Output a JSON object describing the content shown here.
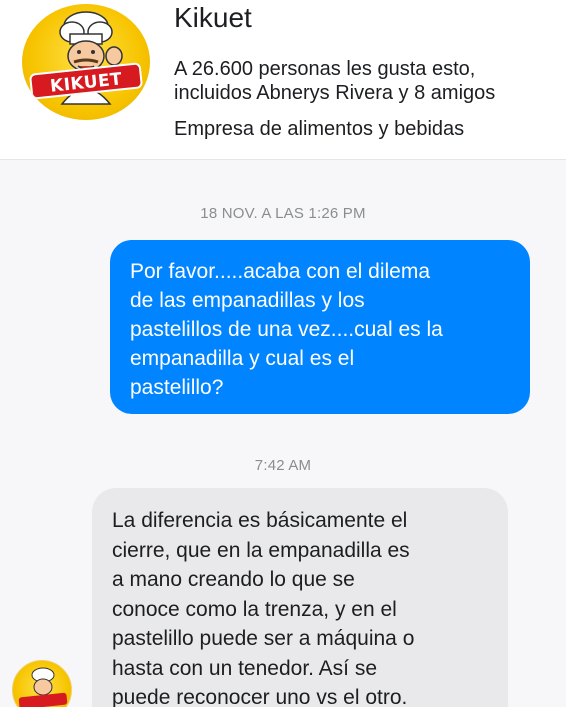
{
  "page": {
    "name": "Kikuet",
    "logo_text": "KIKUET",
    "likes_line1": "A 26.600 personas les gusta esto,",
    "likes_line2": "incluidos Abnerys Rivera y 8 amigos",
    "category": "Empresa de alimentos y bebidas"
  },
  "conversation": {
    "messages": [
      {
        "timestamp": "18 NOV. A LAS 1:26 PM",
        "direction": "outgoing",
        "lines": [
          "Por favor.....acaba con el dilema",
          "de las empanadillas y los",
          "pastelillos de una vez....cual es la",
          "empanadilla y cual es el",
          "pastelillo?"
        ]
      },
      {
        "timestamp": "7:42 AM",
        "direction": "incoming",
        "lines": [
          "La diferencia es básicamente el",
          "cierre, que en la empanadilla es",
          "a mano creando lo que se",
          "conoce como la trenza, y en el",
          "pastelillo puede ser a máquina o",
          "hasta con un tenedor. Así se",
          "puede reconocer uno vs el otro."
        ]
      }
    ]
  },
  "colors": {
    "outgoing_bubble": "#0084ff",
    "incoming_bubble": "#e9e9ec",
    "logo_yellow": "#f7c400",
    "logo_red": "#d71920"
  },
  "icons": {
    "page_logo": "kikuet-chef-logo",
    "sender_avatar": "kikuet-avatar"
  }
}
